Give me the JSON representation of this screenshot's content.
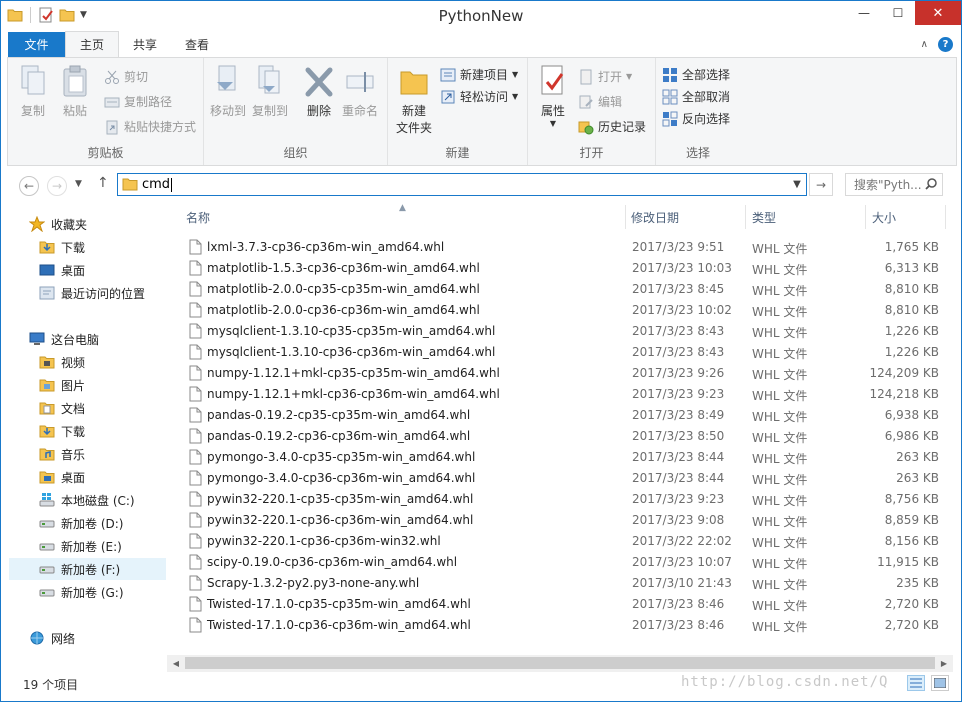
{
  "window": {
    "title": "PythonNew"
  },
  "titlebar": {
    "minimize": "—",
    "maximize": "☐",
    "close": "✕"
  },
  "tabs": [
    {
      "label": "文件"
    },
    {
      "label": "主页"
    },
    {
      "label": "共享"
    },
    {
      "label": "查看"
    }
  ],
  "ribbon": {
    "clipboard": {
      "label": "剪贴板",
      "copy": "复制",
      "paste": "粘贴",
      "cut": "剪切",
      "copy_path": "复制路径",
      "paste_shortcut": "粘贴快捷方式"
    },
    "organize": {
      "label": "组织",
      "move_to": "移动到",
      "copy_to": "复制到",
      "delete": "删除",
      "rename": "重命名"
    },
    "new": {
      "label": "新建",
      "new_folder_line1": "新建",
      "new_folder_line2": "文件夹",
      "new_item": "新建项目",
      "easy_access": "轻松访问"
    },
    "open": {
      "label": "打开",
      "properties": "属性",
      "open": "打开",
      "edit": "编辑",
      "history": "历史记录"
    },
    "select": {
      "label": "选择",
      "select_all": "全部选择",
      "select_none": "全部取消",
      "invert": "反向选择"
    }
  },
  "address": {
    "path": "cmd",
    "search_placeholder": "搜索\"Pyth..."
  },
  "navpane": {
    "favorites": "收藏夹",
    "downloads": "下载",
    "desktop": "桌面",
    "recent": "最近访问的位置",
    "this_pc": "这台电脑",
    "videos": "视频",
    "pictures": "图片",
    "documents": "文档",
    "downloads2": "下载",
    "music": "音乐",
    "desktop2": "桌面",
    "drive_c": "本地磁盘 (C:)",
    "drive_d": "新加卷 (D:)",
    "drive_e": "新加卷 (E:)",
    "drive_f": "新加卷 (F:)",
    "drive_g": "新加卷 (G:)",
    "network": "网络"
  },
  "columns": {
    "name": "名称",
    "date": "修改日期",
    "type": "类型",
    "size": "大小"
  },
  "files": [
    {
      "name": "lxml-3.7.3-cp36-cp36m-win_amd64.whl",
      "date": "2017/3/23 9:51",
      "type": "WHL 文件",
      "size": "1,765 KB"
    },
    {
      "name": "matplotlib-1.5.3-cp36-cp36m-win_amd64.whl",
      "date": "2017/3/23 10:03",
      "type": "WHL 文件",
      "size": "6,313 KB"
    },
    {
      "name": "matplotlib-2.0.0-cp35-cp35m-win_amd64.whl",
      "date": "2017/3/23 8:45",
      "type": "WHL 文件",
      "size": "8,810 KB"
    },
    {
      "name": "matplotlib-2.0.0-cp36-cp36m-win_amd64.whl",
      "date": "2017/3/23 10:02",
      "type": "WHL 文件",
      "size": "8,810 KB"
    },
    {
      "name": "mysqlclient-1.3.10-cp35-cp35m-win_amd64.whl",
      "date": "2017/3/23 8:43",
      "type": "WHL 文件",
      "size": "1,226 KB"
    },
    {
      "name": "mysqlclient-1.3.10-cp36-cp36m-win_amd64.whl",
      "date": "2017/3/23 8:43",
      "type": "WHL 文件",
      "size": "1,226 KB"
    },
    {
      "name": "numpy-1.12.1+mkl-cp35-cp35m-win_amd64.whl",
      "date": "2017/3/23 9:26",
      "type": "WHL 文件",
      "size": "124,209 KB"
    },
    {
      "name": "numpy-1.12.1+mkl-cp36-cp36m-win_amd64.whl",
      "date": "2017/3/23 9:23",
      "type": "WHL 文件",
      "size": "124,218 KB"
    },
    {
      "name": "pandas-0.19.2-cp35-cp35m-win_amd64.whl",
      "date": "2017/3/23 8:49",
      "type": "WHL 文件",
      "size": "6,938 KB"
    },
    {
      "name": "pandas-0.19.2-cp36-cp36m-win_amd64.whl",
      "date": "2017/3/23 8:50",
      "type": "WHL 文件",
      "size": "6,986 KB"
    },
    {
      "name": "pymongo-3.4.0-cp35-cp35m-win_amd64.whl",
      "date": "2017/3/23 8:44",
      "type": "WHL 文件",
      "size": "263 KB"
    },
    {
      "name": "pymongo-3.4.0-cp36-cp36m-win_amd64.whl",
      "date": "2017/3/23 8:44",
      "type": "WHL 文件",
      "size": "263 KB"
    },
    {
      "name": "pywin32-220.1-cp35-cp35m-win_amd64.whl",
      "date": "2017/3/23 9:23",
      "type": "WHL 文件",
      "size": "8,756 KB"
    },
    {
      "name": "pywin32-220.1-cp36-cp36m-win_amd64.whl",
      "date": "2017/3/23 9:08",
      "type": "WHL 文件",
      "size": "8,859 KB"
    },
    {
      "name": "pywin32-220.1-cp36-cp36m-win32.whl",
      "date": "2017/3/22 22:02",
      "type": "WHL 文件",
      "size": "8,156 KB"
    },
    {
      "name": "scipy-0.19.0-cp36-cp36m-win_amd64.whl",
      "date": "2017/3/23 10:07",
      "type": "WHL 文件",
      "size": "11,915 KB"
    },
    {
      "name": "Scrapy-1.3.2-py2.py3-none-any.whl",
      "date": "2017/3/10 21:43",
      "type": "WHL 文件",
      "size": "235 KB"
    },
    {
      "name": "Twisted-17.1.0-cp35-cp35m-win_amd64.whl",
      "date": "2017/3/23 8:46",
      "type": "WHL 文件",
      "size": "2,720 KB"
    },
    {
      "name": "Twisted-17.1.0-cp36-cp36m-win_amd64.whl",
      "date": "2017/3/23 8:46",
      "type": "WHL 文件",
      "size": "2,720 KB"
    }
  ],
  "status": {
    "count": "19 个项目",
    "watermark": "http://blog.csdn.net/Q"
  }
}
